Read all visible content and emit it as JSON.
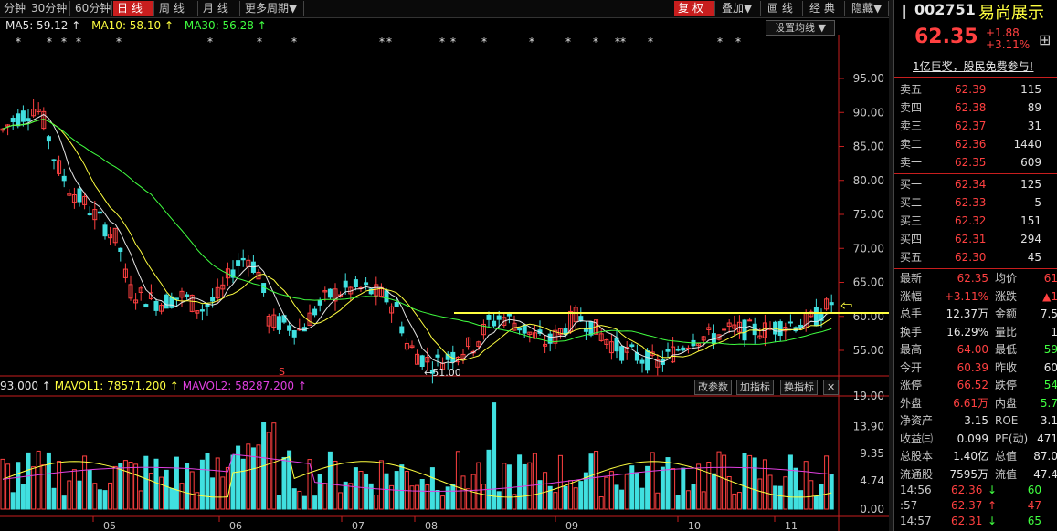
{
  "toolbar": {
    "tabs": [
      "分钟",
      "30分钟",
      "60分钟",
      "日 线",
      "周 线",
      "月 线",
      "更多周期▼"
    ],
    "active_tab": 3,
    "right_buttons": [
      "复 权",
      "叠加▼",
      "画 线",
      "经 典",
      "隐藏▼"
    ]
  },
  "ma_legend": {
    "ma5": "MA5: 59.12 ↑",
    "ma10": "MA10: 58.10 ↑",
    "ma30": "MA30: 56.28 ↑",
    "setting": "设置均线 ▼"
  },
  "vol_legend": {
    "vol": "93.000 ↑",
    "mavol1": "MAVOL1: 78571.200 ↑",
    "mavol2": "MAVOL2: 58287.200 ↑",
    "buttons": [
      "改参数",
      "加指标",
      "换指标",
      "✕"
    ]
  },
  "price_axis": [
    "95.00",
    "90.00",
    "85.00",
    "80.00",
    "75.00",
    "70.00",
    "65.00",
    "60.00",
    "55.00"
  ],
  "vol_axis": [
    "19.00",
    "13.90",
    "9.35",
    "4.74",
    "0.00"
  ],
  "month_axis": [
    "05",
    "06",
    "07",
    "08",
    "09",
    "10",
    "11"
  ],
  "annotations": {
    "low_label": "←51.00",
    "s_mark": "S",
    "stars": "*"
  },
  "colors": {
    "up": "#ff4040",
    "down": "#40e0e0",
    "ma5": "#e6e6e6",
    "ma10": "#ffff40",
    "ma30": "#40ff40",
    "line": "#ffff40"
  },
  "quote": {
    "code": "002751",
    "name": "易尚展示",
    "price": "62.35",
    "change": "+1.88",
    "change_pct": "+3.11%",
    "banner": "1亿巨奖，股民免费参与!"
  },
  "orderbook": [
    {
      "label": "卖五",
      "price": "62.39",
      "vol": "115"
    },
    {
      "label": "卖四",
      "price": "62.38",
      "vol": "89"
    },
    {
      "label": "卖三",
      "price": "62.37",
      "vol": "31"
    },
    {
      "label": "卖二",
      "price": "62.36",
      "vol": "1440"
    },
    {
      "label": "卖一",
      "price": "62.35",
      "vol": "609"
    },
    {
      "label": "买一",
      "price": "62.34",
      "vol": "125"
    },
    {
      "label": "买二",
      "price": "62.33",
      "vol": "5"
    },
    {
      "label": "买三",
      "price": "62.32",
      "vol": "151"
    },
    {
      "label": "买四",
      "price": "62.31",
      "vol": "294"
    },
    {
      "label": "买五",
      "price": "62.30",
      "vol": "45"
    }
  ],
  "stats": [
    {
      "l1": "最新",
      "v1": "62.35",
      "l2": "均价",
      "v2": "61"
    },
    {
      "l1": "涨幅",
      "v1": "+3.11%",
      "l2": "涨跌",
      "v2": "▲1"
    },
    {
      "l1": "总手",
      "v1": "12.37万",
      "l2": "金额",
      "v2": "7.5"
    },
    {
      "l1": "换手",
      "v1": "16.29%",
      "l2": "量比",
      "v2": "1"
    },
    {
      "l1": "最高",
      "v1": "64.00",
      "l2": "最低",
      "v2": "59"
    },
    {
      "l1": "今开",
      "v1": "60.39",
      "l2": "昨收",
      "v2": "60"
    },
    {
      "l1": "涨停",
      "v1": "66.52",
      "l2": "跌停",
      "v2": "54"
    },
    {
      "l1": "外盘",
      "v1": "6.61万",
      "l2": "内盘",
      "v2": "5.7"
    },
    {
      "l1": "净资产",
      "v1": "3.15",
      "l2": "ROE",
      "v2": "3.1"
    },
    {
      "l1": "收益㈢",
      "v1": "0.099",
      "l2": "PE(动)",
      "v2": "471"
    },
    {
      "l1": "总股本",
      "v1": "1.40亿",
      "l2": "总值",
      "v2": "87.0"
    },
    {
      "l1": "流通股",
      "v1": "7595万",
      "l2": "流值",
      "v2": "47.4"
    }
  ],
  "ticks": [
    {
      "time": "14:56",
      "price": "62.36",
      "arrow": "↓",
      "vol": "60"
    },
    {
      "time": ":57",
      "price": "62.37",
      "arrow": "↑",
      "vol": "47"
    },
    {
      "time": "14:57",
      "price": "62.31",
      "arrow": "↓",
      "vol": "65"
    }
  ]
}
